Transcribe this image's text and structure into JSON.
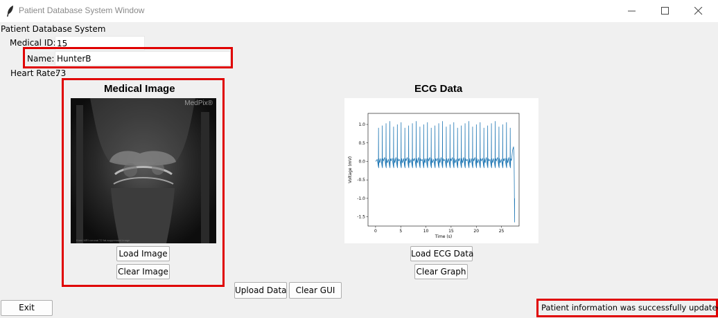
{
  "window": {
    "title": "Patient Database System Window",
    "title_icon": "feather-icon",
    "controls": [
      "minimize-icon",
      "maximize-icon",
      "close-icon"
    ]
  },
  "app": {
    "heading": "Patient Database System"
  },
  "form": {
    "medical_id_label": "Medical ID:",
    "medical_id_value": "15",
    "name_label": "Name:",
    "name_value": "HunterB",
    "heart_rate_label": "Heart Rate:",
    "heart_rate_value": "73"
  },
  "image_panel": {
    "title": "Medical Image",
    "watermark": "MedPix®",
    "caption": "Knee MRI coronal T2 fat-suppressed image",
    "load_button": "Load Image",
    "clear_button": "Clear Image"
  },
  "ecg_panel": {
    "title": "ECG Data",
    "load_button": "Load ECG Data",
    "clear_button": "Clear Graph"
  },
  "actions": {
    "upload_button": "Upload Data",
    "clear_gui_button": "Clear GUI",
    "exit_button": "Exit"
  },
  "status": {
    "message": "Patient information was successfully updated"
  },
  "colors": {
    "highlight": "#e00000",
    "ecg_line": "#1f77b4"
  },
  "chart_data": {
    "type": "line",
    "title": "",
    "xlabel": "Time (s)",
    "ylabel": "Voltage (mV)",
    "xlim": [
      -1.5,
      28.5
    ],
    "ylim": [
      -1.75,
      1.3
    ],
    "x_ticks": [
      0,
      5,
      10,
      15,
      20,
      25
    ],
    "y_ticks": [
      1.0,
      0.5,
      0.0,
      -0.5,
      -1.0,
      -1.5
    ],
    "beat_count": 36,
    "beat_peak_mV": 1.0,
    "beat_trough_mV": -0.15,
    "baseline_mV": 0.0,
    "end_time_s": 27.5,
    "end_drop_mV": -1.65,
    "series": [
      {
        "values": []
      }
    ]
  }
}
